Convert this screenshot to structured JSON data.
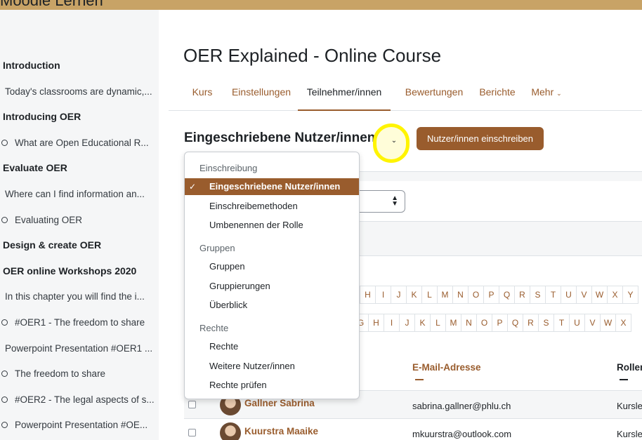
{
  "header": {
    "brand": "Moodle Lernen"
  },
  "sidebar": {
    "items": [
      {
        "kind": "section",
        "label": "Introduction"
      },
      {
        "kind": "text",
        "label": "Today's classrooms are dynamic,..."
      },
      {
        "kind": "section",
        "label": "Introducing OER"
      },
      {
        "kind": "activity",
        "label": "What are Open Educational R..."
      },
      {
        "kind": "section",
        "label": "Evaluate OER"
      },
      {
        "kind": "text",
        "label": "Where can I find information an..."
      },
      {
        "kind": "activity",
        "label": "Evaluating OER"
      },
      {
        "kind": "section",
        "label": "Design & create OER"
      },
      {
        "kind": "section",
        "label": "OER online Workshops 2020"
      },
      {
        "kind": "text",
        "label": "In this chapter you will find the i..."
      },
      {
        "kind": "activity",
        "label": "#OER1 - The freedom to share"
      },
      {
        "kind": "text",
        "label": "Powerpoint Presentation #OER1 ..."
      },
      {
        "kind": "activity",
        "label": "The freedom to share"
      },
      {
        "kind": "activity",
        "label": "#OER2 - The legal aspects of s..."
      },
      {
        "kind": "activity",
        "label": "Powerpoint Presentation #OE..."
      }
    ]
  },
  "course": {
    "title": "OER Explained - Online Course"
  },
  "tabs": [
    {
      "label": "Kurs"
    },
    {
      "label": "Einstellungen"
    },
    {
      "label": "Teilnehmer/innen"
    },
    {
      "label": "Bewertungen"
    },
    {
      "label": "Berichte"
    },
    {
      "label": "Mehr"
    }
  ],
  "page": {
    "heading": "Eingeschriebene Nutzer/innen",
    "enrol_button": "Nutzer/innen einschreiben"
  },
  "dropdown": {
    "groups": [
      {
        "label": "Einschreibung",
        "items": [
          {
            "label": "Eingeschriebene Nutzer/innen",
            "active": true
          },
          {
            "label": "Einschreibemethoden"
          },
          {
            "label": "Umbenennen der Rolle"
          }
        ]
      },
      {
        "label": "Gruppen",
        "items": [
          {
            "label": "Gruppen"
          },
          {
            "label": "Gruppierungen"
          },
          {
            "label": "Überblick"
          }
        ]
      },
      {
        "label": "Rechte",
        "items": [
          {
            "label": "Rechte"
          },
          {
            "label": "Weitere Nutzer/innen"
          },
          {
            "label": "Rechte prüfen"
          }
        ]
      }
    ]
  },
  "letters_row1": [
    "H",
    "I",
    "J",
    "K",
    "L",
    "M",
    "N",
    "O",
    "P",
    "Q",
    "R",
    "S",
    "T",
    "U",
    "V",
    "W",
    "X",
    "Y"
  ],
  "letters_row2": [
    "G",
    "H",
    "I",
    "J",
    "K",
    "L",
    "M",
    "N",
    "O",
    "P",
    "Q",
    "R",
    "S",
    "T",
    "U",
    "V",
    "W",
    "X"
  ],
  "table": {
    "headers": {
      "email": "E-Mail-Adresse",
      "roles": "Rollen"
    },
    "rows": [
      {
        "name": "Gallner Sabrina",
        "email": "sabrina.gallner@phlu.ch",
        "role": "Kursleiter/in"
      },
      {
        "name": "Kuurstra Maaike",
        "email": "mkuurstra@outlook.com",
        "role": "Kursleiter/in"
      }
    ]
  },
  "colors": {
    "accent": "#995c2d",
    "topbar": "#c8a366",
    "highlight": "#fff400"
  }
}
